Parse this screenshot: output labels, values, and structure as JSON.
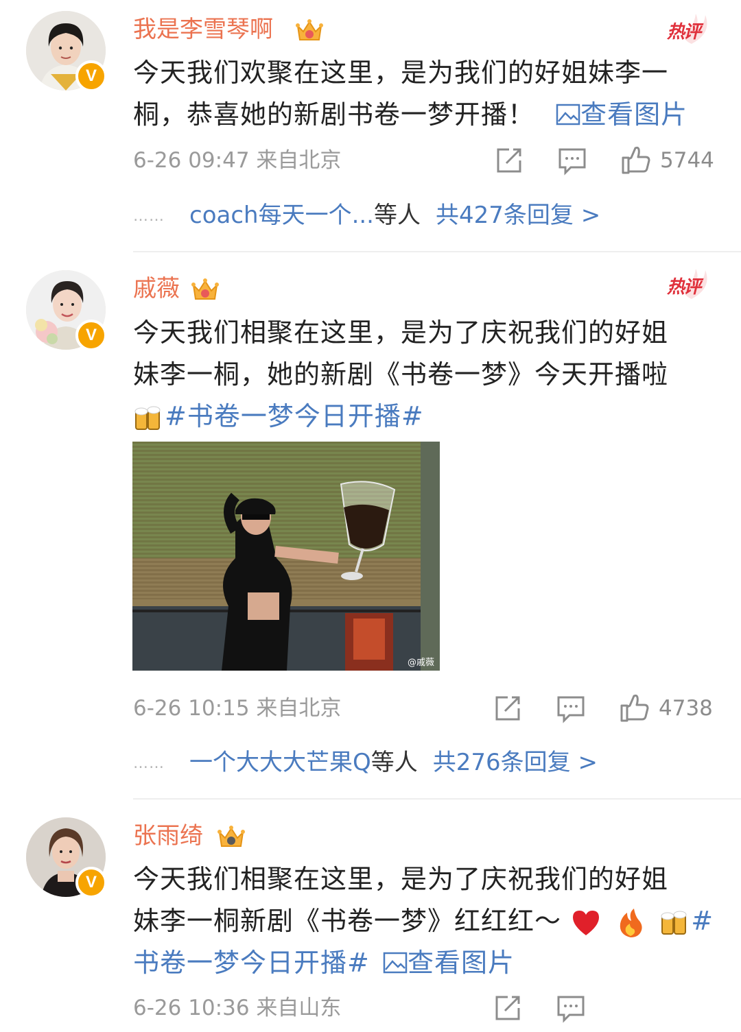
{
  "badge_text": "热评",
  "verified_mark": "V",
  "colors": {
    "username": "#eb7350",
    "link": "#4a7bbf",
    "meta": "#9a9a9a",
    "hot": "#e0303b",
    "verified": "#f7a400"
  },
  "icons": [
    "crown-icon",
    "verified-icon",
    "hot-comment-badge",
    "repost-icon",
    "comment-icon",
    "like-icon",
    "image-icon",
    "beer-emoji",
    "heart-emoji",
    "fire-emoji"
  ],
  "comments": [
    {
      "username": "我是李雪琴啊",
      "text_line1": "今天我们欢聚在这里，是为我们的好姐妹李一",
      "text_line2": "桐，恭喜她的新剧书卷一梦开播！",
      "view_image": "查看图片",
      "time": "6-26 09:47",
      "location": "来自北京",
      "likes": "5744",
      "reply_dots": "……",
      "reply_user": "coach每天一个...",
      "reply_etc": "等人",
      "reply_total": "共427条回复 >"
    },
    {
      "username": "戚薇",
      "text_line1": "今天我们相聚在这里，是为了庆祝我们的好姐",
      "text_line2": "妹李一桐，她的新剧《书卷一梦》今天开播啦",
      "hashtag": "#书卷一梦今日开播#",
      "photo_watermark": "@戚薇",
      "time": "6-26 10:15",
      "location": "来自北京",
      "likes": "4738",
      "reply_dots": "……",
      "reply_user": "一个大大大芒果Q",
      "reply_etc": "等人",
      "reply_total": "共276条回复 >"
    },
    {
      "username": "张雨绮",
      "text_line1": "今天我们相聚在这里，是为了庆祝我们的好姐",
      "text_line2": "妹李一桐新剧《书卷一梦》红红红～",
      "hashtag_start": "#",
      "hashtag_rest": "书卷一梦今日开播#",
      "view_image": "查看图片",
      "time": "6-26 10:36",
      "location": "来自山东"
    }
  ]
}
